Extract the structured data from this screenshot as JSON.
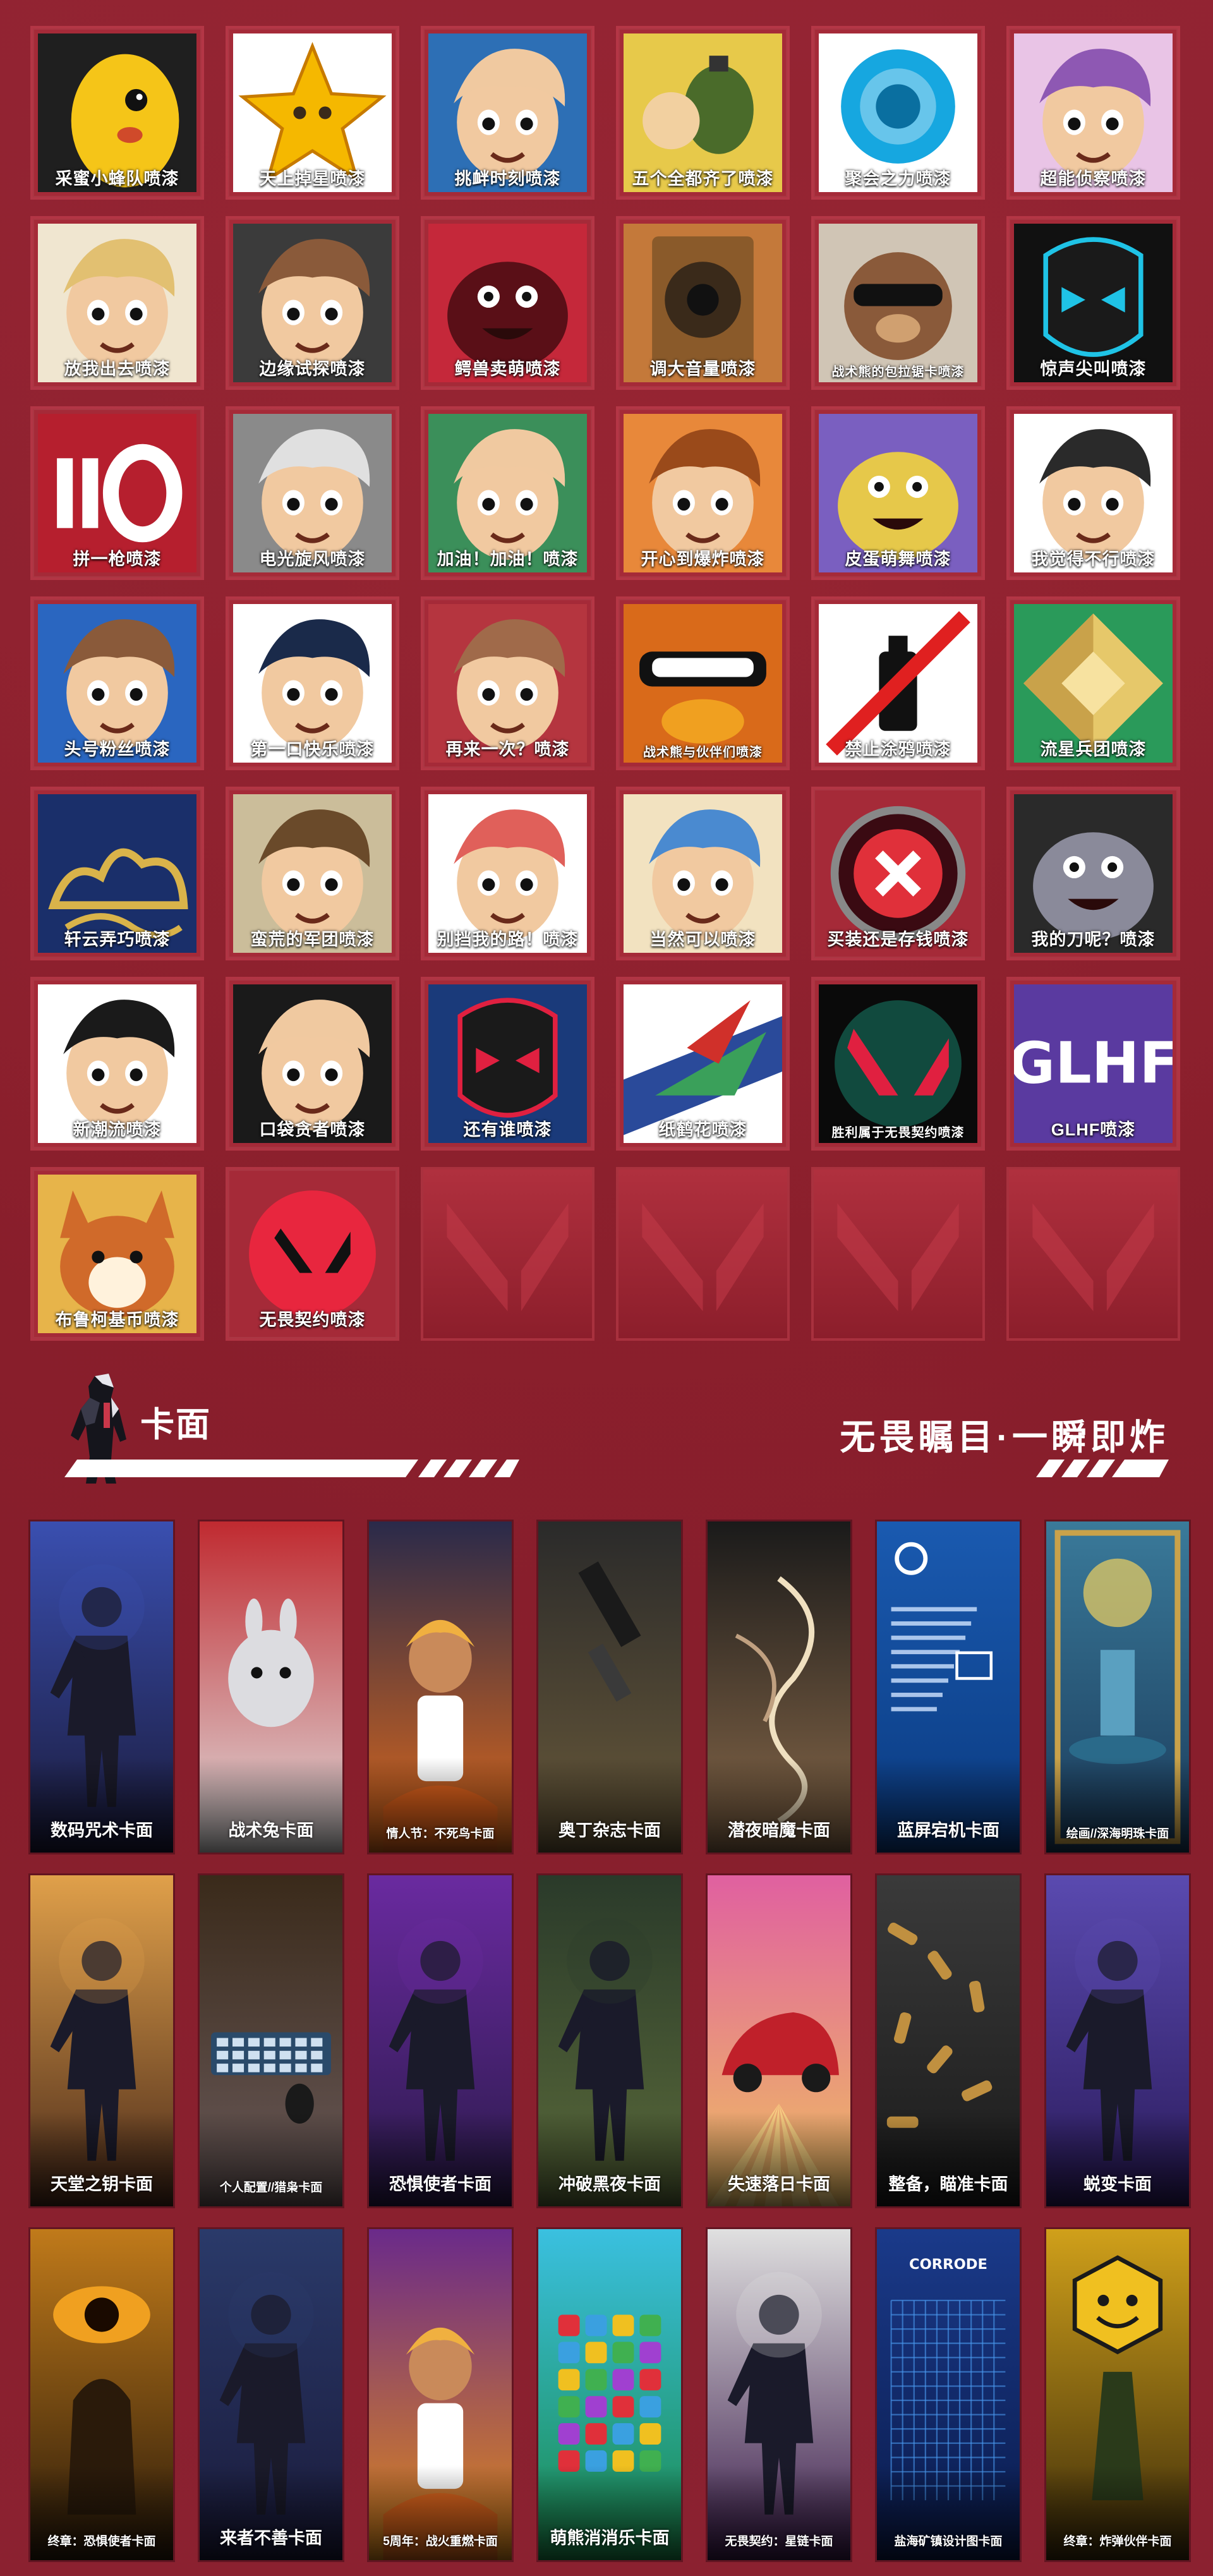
{
  "sprays": [
    {
      "label": "采蜜小蜂队喷漆",
      "icon": "bee-mascot-icon",
      "bg": "#1f1f1f",
      "accent": "#f5c518",
      "small": false
    },
    {
      "label": "天上掉星喷漆",
      "icon": "star-icon",
      "bg": "#ffffff",
      "accent": "#f5b800",
      "small": false
    },
    {
      "label": "挑衅时刻喷漆",
      "icon": "agent-face-icon",
      "bg": "#2d6fb5",
      "accent": "#f0c9a0",
      "small": false
    },
    {
      "label": "五个全都齐了喷漆",
      "icon": "grenade-icon",
      "bg": "#e7c94a",
      "accent": "#4a6b2a",
      "small": false
    },
    {
      "label": "聚会之力喷漆",
      "icon": "orb-icon",
      "bg": "#ffffff",
      "accent": "#16a7e0",
      "small": false
    },
    {
      "label": "超能侦察喷漆",
      "icon": "agent-face-icon",
      "bg": "#e9c4e6",
      "accent": "#8e58b3",
      "small": false
    },
    {
      "label": "放我出去喷漆",
      "icon": "agent-face-icon",
      "bg": "#f0e6d0",
      "accent": "#e2c071",
      "small": false
    },
    {
      "label": "边缘试探喷漆",
      "icon": "agent-face-icon",
      "bg": "#3b3b3b",
      "accent": "#8a5a3a",
      "small": false
    },
    {
      "label": "鳄兽卖萌喷漆",
      "icon": "creature-icon",
      "bg": "#c5283a",
      "accent": "#5a0f17",
      "small": false
    },
    {
      "label": "调大音量喷漆",
      "icon": "speaker-icon",
      "bg": "#c4793a",
      "accent": "#3a2a1a",
      "small": false
    },
    {
      "label": "战术熊的包拉锯卡喷漆",
      "icon": "bear-icon",
      "bg": "#d0c5b5",
      "accent": "#6a4a2a",
      "small": true
    },
    {
      "label": "惊声尖叫喷漆",
      "icon": "mask-icon",
      "bg": "#111111",
      "accent": "#1fc3e6",
      "small": false
    },
    {
      "label": "拼一枪喷漆",
      "icon": "number-icon",
      "bg": "#b61f2e",
      "accent": "#ffffff",
      "small": false
    },
    {
      "label": "电光旋风喷漆",
      "icon": "agent-face-icon",
      "bg": "#8a8a8a",
      "accent": "#e0e0e0",
      "small": false
    },
    {
      "label": "加油！加油！喷漆",
      "icon": "agent-face-icon",
      "bg": "#3b8f5a",
      "accent": "#f0c9a0",
      "small": false
    },
    {
      "label": "开心到爆炸喷漆",
      "icon": "agent-face-icon",
      "bg": "#e8883a",
      "accent": "#9a4a1a",
      "small": false
    },
    {
      "label": "皮蛋萌舞喷漆",
      "icon": "creature-icon",
      "bg": "#7a5fc0",
      "accent": "#e6c84a",
      "small": false
    },
    {
      "label": "我觉得不行喷漆",
      "icon": "agent-face-icon",
      "bg": "#ffffff",
      "accent": "#2a2a2a",
      "small": false
    },
    {
      "label": "头号粉丝喷漆",
      "icon": "agent-face-icon",
      "bg": "#2a66c0",
      "accent": "#8a5a3a",
      "small": false
    },
    {
      "label": "第一口快乐喷漆",
      "icon": "agent-face-icon",
      "bg": "#ffffff",
      "accent": "#1a2a4a",
      "small": false
    },
    {
      "label": "再来一次？喷漆",
      "icon": "agent-face-icon",
      "bg": "#b5353f",
      "accent": "#a06a4a",
      "small": false
    },
    {
      "label": "战术熊与伙伴们喷漆",
      "icon": "duck-icon",
      "bg": "#d96a1a",
      "accent": "#ffffff",
      "small": true
    },
    {
      "label": "禁止涂鸦喷漆",
      "icon": "no-spray-icon",
      "bg": "#ffffff",
      "accent": "#e02020",
      "small": false
    },
    {
      "label": "流星兵团喷漆",
      "icon": "gem-icon",
      "bg": "#2a9a5a",
      "accent": "#e6c86a",
      "small": false
    },
    {
      "label": "轩云弄巧喷漆",
      "icon": "cloud-icon",
      "bg": "#1a2f6a",
      "accent": "#d9b34a",
      "small": false
    },
    {
      "label": "蛮荒的军团喷漆",
      "icon": "agent-face-icon",
      "bg": "#cbbd9a",
      "accent": "#6a4a2a",
      "small": false
    },
    {
      "label": "别挡我的路！喷漆",
      "icon": "agent-face-icon",
      "bg": "#ffffff",
      "accent": "#e0605a",
      "small": false
    },
    {
      "label": "当然可以喷漆",
      "icon": "agent-face-icon",
      "bg": "#f2e2c0",
      "accent": "#4a8ad0",
      "small": false
    },
    {
      "label": "买装还是存钱喷漆",
      "icon": "cross-circle-icon",
      "bg": "#a52a38",
      "accent": "#ffffff",
      "small": false
    },
    {
      "label": "我的刀呢？喷漆",
      "icon": "creature-icon",
      "bg": "#2a2a2a",
      "accent": "#8a8a9a",
      "small": false
    },
    {
      "label": "新潮流喷漆",
      "icon": "agent-face-icon",
      "bg": "#ffffff",
      "accent": "#1a1a1a",
      "small": false
    },
    {
      "label": "口袋贪者喷漆",
      "icon": "agent-face-icon",
      "bg": "#1a1a1a",
      "accent": "#f0c9a0",
      "small": false
    },
    {
      "label": "还有谁喷漆",
      "icon": "mask-icon",
      "bg": "#1a3a7a",
      "accent": "#e02040",
      "small": false
    },
    {
      "label": "纸鹤花喷漆",
      "icon": "flower-icon",
      "bg": "#ffffff",
      "accent": "#d0302a",
      "small": false
    },
    {
      "label": "胜利属于无畏契约喷漆",
      "icon": "valorant-logo-icon",
      "bg": "#0a0a0a",
      "accent": "#1fc3a0",
      "small": true
    },
    {
      "label": "GLHF喷漆",
      "icon": "graffiti-icon",
      "bg": "#5a3aa0",
      "accent": "#ffffff",
      "small": false
    },
    {
      "label": "布鲁柯基币喷漆",
      "icon": "corgi-icon",
      "bg": "#e7b44a",
      "accent": "#d06a2a",
      "small": false
    },
    {
      "label": "无畏契约喷漆",
      "icon": "valorant-logo-icon",
      "bg": "#a52a38",
      "accent": "#e8263e",
      "small": false
    }
  ],
  "empty_slot_count": 4,
  "section": {
    "title": "卡面",
    "slogan": "无畏瞩目·一瞬即炸"
  },
  "cards": [
    {
      "label": "数码咒术卡面",
      "icon": "agent-silhouette-icon",
      "top": "#3a4fb0",
      "bottom": "#1a1a3a",
      "small": false
    },
    {
      "label": "战术兔卡面",
      "icon": "rabbit-icon",
      "top": "#c02a30",
      "bottom": "#e0e0e0",
      "small": false
    },
    {
      "label": "情人节：不死鸟卡面",
      "icon": "agent-face-icon",
      "top": "#2a2a4a",
      "bottom": "#e06a1a",
      "small": true
    },
    {
      "label": "奥丁杂志卡面",
      "icon": "gun-icon",
      "top": "#2a2a2a",
      "bottom": "#6a5a3a",
      "small": false
    },
    {
      "label": "潜夜暗魔卡面",
      "icon": "swirl-icon",
      "top": "#1a1a1a",
      "bottom": "#8a6a4a",
      "small": false
    },
    {
      "label": "蓝屏宕机卡面",
      "icon": "bluescreen-icon",
      "top": "#1a5ab0",
      "bottom": "#0a3a80",
      "small": false
    },
    {
      "label": "绘画//深海明珠卡面",
      "icon": "fountain-icon",
      "top": "#3a7a9a",
      "bottom": "#1a3a5a",
      "small": true
    },
    {
      "label": "天堂之钥卡面",
      "icon": "agent-silhouette-icon",
      "top": "#e0a04a",
      "bottom": "#4a2a1a",
      "small": false
    },
    {
      "label": "个人配置//猎枭卡面",
      "icon": "keyboard-icon",
      "top": "#3a2a1a",
      "bottom": "#6a5a5a",
      "small": true
    },
    {
      "label": "恐惧使者卡面",
      "icon": "agent-silhouette-icon",
      "top": "#6a2aa0",
      "bottom": "#2a1a4a",
      "small": false
    },
    {
      "label": "冲破黑夜卡面",
      "icon": "agent-silhouette-icon",
      "top": "#2a3a2a",
      "bottom": "#5a6a3a",
      "small": false
    },
    {
      "label": "失速落日卡面",
      "icon": "car-icon",
      "top": "#e060a0",
      "bottom": "#f0c060",
      "small": false
    },
    {
      "label": "整备，瞄准卡面",
      "icon": "bullets-icon",
      "top": "#3a3a3a",
      "bottom": "#1a1a1a",
      "small": false
    },
    {
      "label": "蜕变卡面",
      "icon": "agent-silhouette-icon",
      "top": "#5a4ab0",
      "bottom": "#2a1a5a",
      "small": false
    },
    {
      "label": "终章：恐惧使者卡面",
      "icon": "eye-icon",
      "top": "#c07a1a",
      "bottom": "#2a1a0a",
      "small": true
    },
    {
      "label": "来者不善卡面",
      "icon": "agent-silhouette-icon",
      "top": "#2a3a6a",
      "bottom": "#1a1a3a",
      "small": false
    },
    {
      "label": "5周年：战火重燃卡面",
      "icon": "agent-face-icon",
      "top": "#6a2a8a",
      "bottom": "#e08a1a",
      "small": true
    },
    {
      "label": "萌熊消消乐卡面",
      "icon": "puzzle-icon",
      "top": "#3ac0e0",
      "bottom": "#1a8a4a",
      "small": false
    },
    {
      "label": "无畏契约：星链卡面",
      "icon": "agent-silhouette-icon",
      "top": "#e0e0e0",
      "bottom": "#3a1a4a",
      "small": true
    },
    {
      "label": "盐海矿镇设计图卡面",
      "icon": "blueprint-icon",
      "top": "#1a3a8a",
      "bottom": "#0a1a4a",
      "small": true
    },
    {
      "label": "终章：炸弹伙伴卡面",
      "icon": "smile-badge-icon",
      "top": "#d0a01a",
      "bottom": "#3a2a0a",
      "small": true
    }
  ],
  "colors": {
    "background": "#8b1f2b",
    "tile": "#a52a38",
    "tile_border": "#cd4655",
    "accent_stripe": "#ffffff"
  }
}
